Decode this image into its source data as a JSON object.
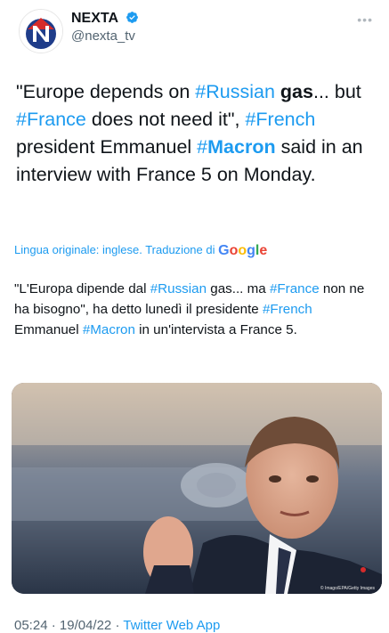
{
  "user": {
    "display_name": "NEXTA",
    "handle": "@nexta_tv",
    "verified": true,
    "avatar_icon": "nexta-logo-icon"
  },
  "tweet": {
    "text_segments": [
      {
        "text": "\"Europe depends on ",
        "style": "plain"
      },
      {
        "text": "#Russian",
        "style": "hashtag"
      },
      {
        "text": " ",
        "style": "plain"
      },
      {
        "text": "gas",
        "style": "bold"
      },
      {
        "text": "... but ",
        "style": "plain"
      },
      {
        "text": "#France",
        "style": "hashtag"
      },
      {
        "text": " does not need it\", ",
        "style": "plain"
      },
      {
        "text": "#French",
        "style": "hashtag"
      },
      {
        "text": " president Emmanuel ",
        "style": "plain"
      },
      {
        "text": "#",
        "style": "hashtag"
      },
      {
        "text": "Macron",
        "style": "hashtag-bold"
      },
      {
        "text": " said in an interview with France 5 on Monday.",
        "style": "plain"
      }
    ],
    "translation_label": "Lingua originale: inglese. Traduzione di",
    "translation_provider": "Google",
    "translated_segments": [
      {
        "text": "\"L'Europa dipende dal ",
        "style": "plain"
      },
      {
        "text": "#Russian",
        "style": "hashtag"
      },
      {
        "text": " gas... ma ",
        "style": "plain"
      },
      {
        "text": "#France",
        "style": "hashtag"
      },
      {
        "text": " non ne ha bisogno\", ha detto lunedì il presidente ",
        "style": "plain"
      },
      {
        "text": "#French",
        "style": "hashtag"
      },
      {
        "text": " Emmanuel ",
        "style": "plain"
      },
      {
        "text": "#Macron",
        "style": "hashtag"
      },
      {
        "text": " in un'intervista a France 5.",
        "style": "plain"
      }
    ],
    "image_alt": "Photo of Emmanuel Macron speaking",
    "image_credit": "© Imago/EPA/Getty Images",
    "time": "05:24",
    "date": "19/04/22",
    "separator": "·",
    "source": "Twitter Web App"
  },
  "colors": {
    "link": "#1d9bf0",
    "text": "#0f1419",
    "secondary": "#536471"
  },
  "icons": {
    "more": "more-dots-icon",
    "verified": "verified-badge-icon"
  }
}
